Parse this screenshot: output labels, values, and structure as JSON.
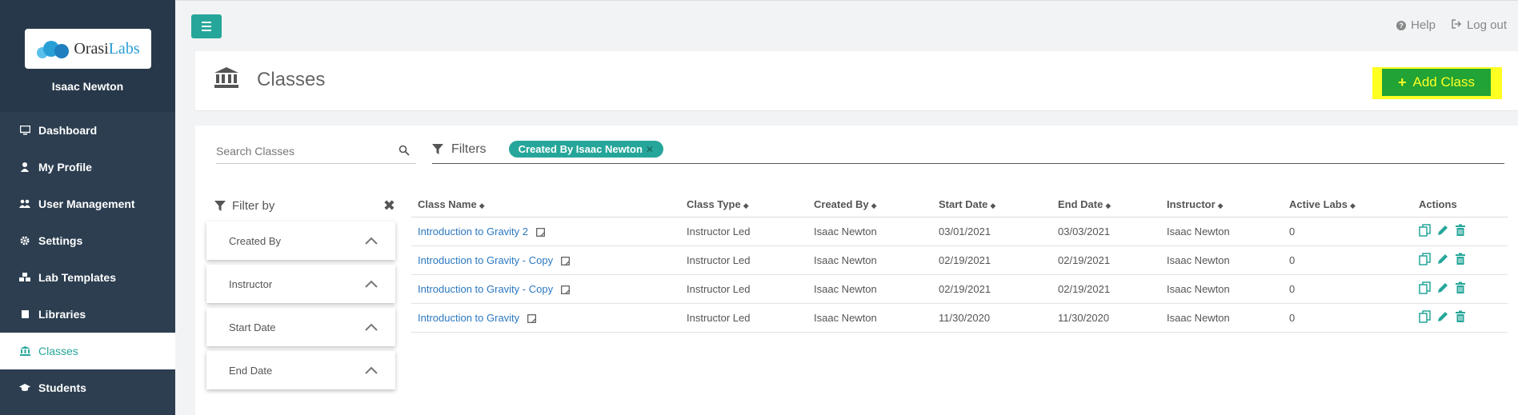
{
  "brand": {
    "logo_text_a": "Orasi",
    "logo_text_b": "Labs",
    "user": "Isaac Newton"
  },
  "sidebar": {
    "items": [
      {
        "label": "Dashboard",
        "icon": "desktop-icon"
      },
      {
        "label": "My Profile",
        "icon": "user-icon"
      },
      {
        "label": "User Management",
        "icon": "users-icon"
      },
      {
        "label": "Settings",
        "icon": "gear-icon"
      },
      {
        "label": "Lab Templates",
        "icon": "cubes-icon"
      },
      {
        "label": "Libraries",
        "icon": "book-icon"
      },
      {
        "label": "Classes",
        "icon": "institution-icon",
        "active": true
      },
      {
        "label": "Students",
        "icon": "graduation-cap-icon"
      }
    ]
  },
  "topbar": {
    "help": "Help",
    "logout": "Log out"
  },
  "header": {
    "title": "Classes",
    "add_button": "Add Class"
  },
  "search": {
    "placeholder": "Search Classes",
    "value": ""
  },
  "filters": {
    "label": "Filters",
    "chip": "Created By Isaac Newton"
  },
  "filter_by": {
    "label": "Filter by",
    "sections": [
      "Created By",
      "Instructor",
      "Start Date",
      "End Date"
    ]
  },
  "table": {
    "columns": [
      "Class Name",
      "Class Type",
      "Created By",
      "Start Date",
      "End Date",
      "Instructor",
      "Active Labs",
      "Actions"
    ],
    "rows": [
      {
        "name": "Introduction to Gravity 2",
        "type": "Instructor Led",
        "created_by": "Isaac Newton",
        "start": "03/01/2021",
        "end": "03/03/2021",
        "instructor": "Isaac Newton",
        "active_labs": "0"
      },
      {
        "name": "Introduction to Gravity - Copy",
        "type": "Instructor Led",
        "created_by": "Isaac Newton",
        "start": "02/19/2021",
        "end": "02/19/2021",
        "instructor": "Isaac Newton",
        "active_labs": "0"
      },
      {
        "name": "Introduction to Gravity - Copy",
        "type": "Instructor Led",
        "created_by": "Isaac Newton",
        "start": "02/19/2021",
        "end": "02/19/2021",
        "instructor": "Isaac Newton",
        "active_labs": "0"
      },
      {
        "name": "Introduction to Gravity",
        "type": "Instructor Led",
        "created_by": "Isaac Newton",
        "start": "11/30/2020",
        "end": "11/30/2020",
        "instructor": "Isaac Newton",
        "active_labs": "0"
      }
    ]
  },
  "colors": {
    "sidebar": "#2c3e50",
    "accent": "#26a69a",
    "add_button": "#21a336",
    "highlight": "#ffff22",
    "link": "#2c78c0"
  }
}
